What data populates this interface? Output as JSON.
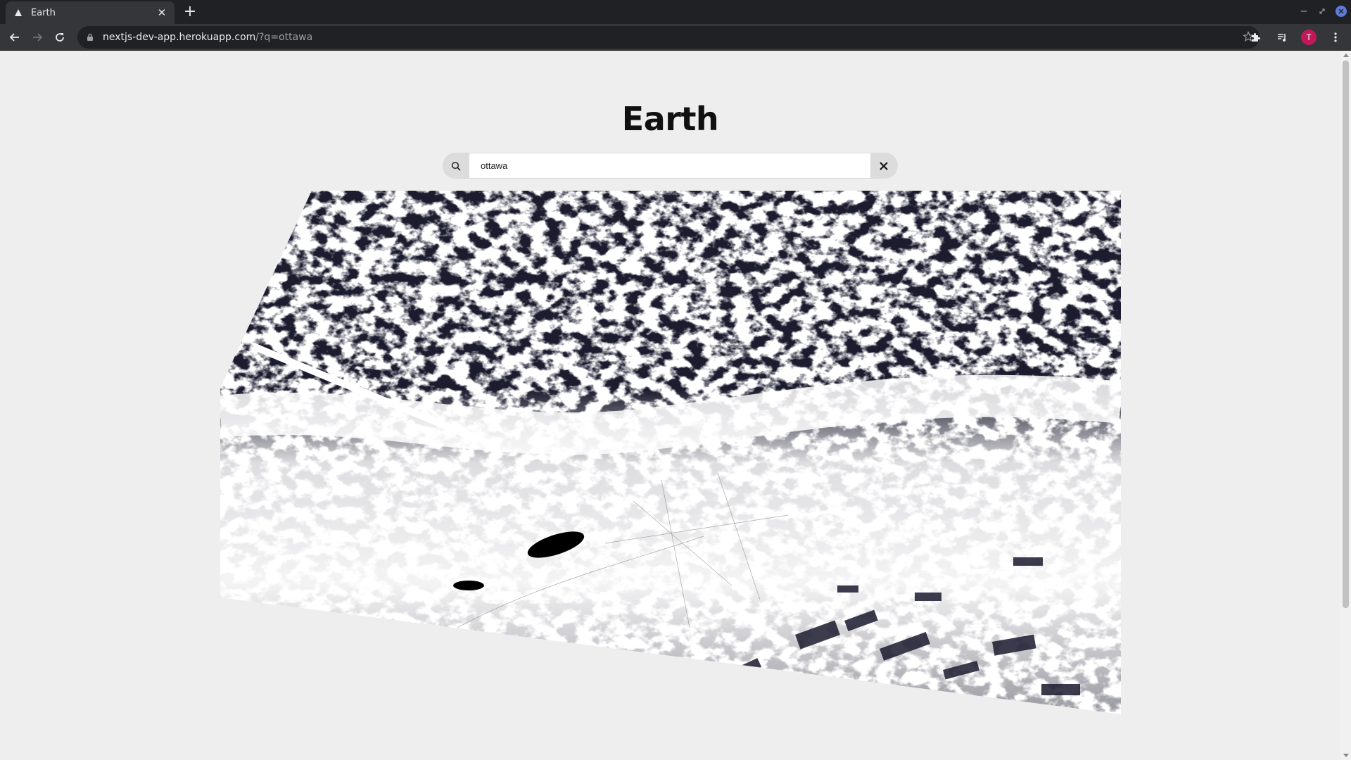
{
  "browser": {
    "tab_title": "Earth",
    "url_host": "nextjs-dev-app.herokuapp.com",
    "url_path": "/?q=ottawa",
    "profile_initial": "T",
    "profile_color": "#c2185b"
  },
  "page": {
    "title": "Earth",
    "search_value": "ottawa"
  },
  "colors": {
    "page_background": "#eeeeee",
    "map_dark": "#1a1a2e",
    "map_light": "#ffffff"
  },
  "icons": {
    "search": "search-icon",
    "clear": "close-icon",
    "back": "back-arrow-icon",
    "forward": "forward-arrow-icon",
    "reload": "reload-icon",
    "lock": "lock-icon",
    "star": "star-icon",
    "extensions": "puzzle-icon",
    "media": "media-control-icon",
    "menu": "kebab-menu-icon"
  }
}
